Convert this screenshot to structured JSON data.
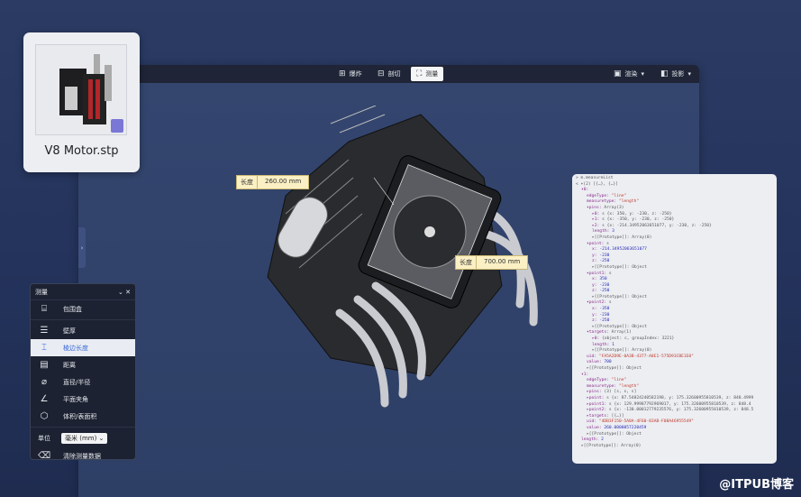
{
  "file_card": {
    "name": "V8 Motor.stp"
  },
  "toolbar": {
    "explode": "爆炸",
    "section": "剖切",
    "measure": "测量",
    "render": "渲染",
    "projection": "投影"
  },
  "labels": [
    {
      "title": "长度",
      "value": "260.00 mm"
    },
    {
      "title": "长度",
      "value": "700.00 mm"
    }
  ],
  "measure_panel": {
    "title": "测量",
    "items": [
      {
        "label": "包围盒",
        "icon": "bounding-box-icon"
      },
      {
        "label": "壁厚",
        "icon": "wall-thickness-icon"
      },
      {
        "label": "棱边长度",
        "icon": "edge-length-icon",
        "selected": true
      },
      {
        "label": "距离",
        "icon": "distance-icon"
      },
      {
        "label": "直径/半径",
        "icon": "diameter-icon"
      },
      {
        "label": "平面夹角",
        "icon": "angle-icon"
      },
      {
        "label": "体积/表面积",
        "icon": "volume-icon"
      }
    ],
    "unit_label": "单位",
    "unit_value": "毫米 (mm)",
    "clear_label": "清除测量数据"
  },
  "console": {
    "lines": [
      [
        0,
        "g",
        "> m.measureList"
      ],
      [
        0,
        "g",
        "< ▾(2) [{…}, {…}]"
      ],
      [
        1,
        "k",
        "▾0:"
      ],
      [
        2,
        "k",
        "edgeType: ",
        "s",
        "\"line\""
      ],
      [
        2,
        "k",
        "measuretype: ",
        "s",
        "\"length\""
      ],
      [
        2,
        "k",
        "▾pins: ",
        "g",
        "Array(3)"
      ],
      [
        3,
        "k",
        "▸0: ",
        "g",
        "s {x: 350, y: -230, z: -250}"
      ],
      [
        3,
        "k",
        "▸1: ",
        "g",
        "s {x: -350, y: -230, z: -250}"
      ],
      [
        3,
        "k",
        "▸2: ",
        "g",
        "s {x: -214.34952063651077, y: -230, z: -250}"
      ],
      [
        3,
        "k",
        "length: ",
        "n",
        "3"
      ],
      [
        3,
        "g",
        "▸[[Prototype]]: Array(0)"
      ],
      [
        2,
        "k",
        "▾point: ",
        "g",
        "s"
      ],
      [
        3,
        "k",
        "x: ",
        "n",
        "-214.34952063651077"
      ],
      [
        3,
        "k",
        "y: ",
        "n",
        "-230"
      ],
      [
        3,
        "k",
        "z: ",
        "n",
        "-250"
      ],
      [
        3,
        "g",
        "▸[[Prototype]]: Object"
      ],
      [
        2,
        "k",
        "▾point1: ",
        "g",
        "s"
      ],
      [
        3,
        "k",
        "x: ",
        "n",
        "350"
      ],
      [
        3,
        "k",
        "y: ",
        "n",
        "-230"
      ],
      [
        3,
        "k",
        "z: ",
        "n",
        "-250"
      ],
      [
        3,
        "g",
        "▸[[Prototype]]: Object"
      ],
      [
        2,
        "k",
        "▾point2: ",
        "g",
        "s"
      ],
      [
        3,
        "k",
        "x: ",
        "n",
        "-350"
      ],
      [
        3,
        "k",
        "y: ",
        "n",
        "-230"
      ],
      [
        3,
        "k",
        "z: ",
        "n",
        "-250"
      ],
      [
        3,
        "g",
        "▸[[Prototype]]: Object"
      ],
      [
        2,
        "k",
        "▾targets: ",
        "g",
        "Array(1)"
      ],
      [
        3,
        "k",
        "▸0: ",
        "g",
        "{object: c, groupIndex: 3221}"
      ],
      [
        3,
        "k",
        "length: ",
        "n",
        "1"
      ],
      [
        3,
        "g",
        "▸[[Prototype]]: Array(0)"
      ],
      [
        2,
        "k",
        "uid: ",
        "s",
        "\"FA5A2D9E-0A3B-4377-A8E1-575D93CBE1E0\""
      ],
      [
        2,
        "k",
        "value: ",
        "n",
        "700"
      ],
      [
        2,
        "g",
        "▸[[Prototype]]: Object"
      ],
      [
        1,
        "k",
        "▾1:"
      ],
      [
        2,
        "k",
        "edgeType: ",
        "s",
        "\"line\""
      ],
      [
        2,
        "k",
        "measuretype: ",
        "s",
        "\"length\""
      ],
      [
        2,
        "k",
        "▸pins: ",
        "g",
        "(3) [s, s, s]"
      ],
      [
        2,
        "k",
        "▸point: ",
        "g",
        "s {x: 87.54824240582198, y: 175.32600955810539, z: 848.4999"
      ],
      [
        2,
        "k",
        "▸point1: ",
        "g",
        "s {x: 129.99987792969017, y: 175.32600955810539, z: 848.4"
      ],
      [
        2,
        "k",
        "▸point2: ",
        "g",
        "s {x: -130.00012779235576, y: 175.32600955810539, z: 848.5"
      ],
      [
        2,
        "k",
        "▸targets: ",
        "g",
        "[{…}]"
      ],
      [
        2,
        "k",
        "uid: ",
        "s",
        "\"4DB3F150-5A8A-4F60-83AB-F08A46955549\""
      ],
      [
        2,
        "k",
        "value: ",
        "n",
        "260.0000057220459"
      ],
      [
        2,
        "g",
        "▸[[Prototype]]: Object"
      ],
      [
        1,
        "k",
        "length: ",
        "n",
        "2"
      ],
      [
        1,
        "g",
        "▸[[Prototype]]: Array(0)"
      ]
    ]
  },
  "watermark": "@ITPUB博客"
}
